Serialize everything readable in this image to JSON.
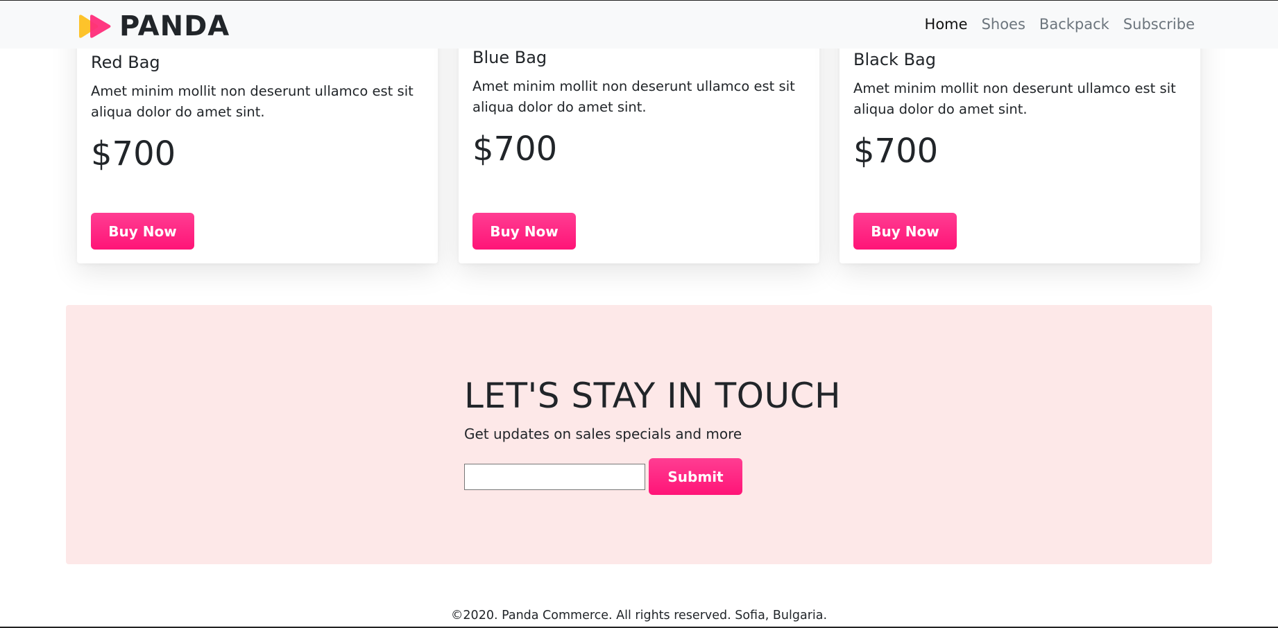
{
  "navbar": {
    "brand": "PANDA",
    "logo_icon": "panda-play-logo",
    "links": [
      "Home",
      "Shoes",
      "Backpack",
      "Subscribe"
    ],
    "active_link": "Home"
  },
  "products": [
    {
      "title": "Red Bag",
      "description": "Amet minim mollit non deserunt ullamco est sit aliqua dolor do amet sint.",
      "price": "$700",
      "button": "Buy Now"
    },
    {
      "title": "Blue Bag",
      "description": "Amet minim mollit non deserunt ullamco est sit aliqua dolor do amet sint.",
      "price": "$700",
      "button": "Buy Now"
    },
    {
      "title": "Black Bag",
      "description": "Amet minim mollit non deserunt ullamco est sit aliqua dolor do amet sint.",
      "price": "$700",
      "button": "Buy Now"
    }
  ],
  "subscribe": {
    "title": "LET'S STAY IN TOUCH",
    "subtitle": "Get updates on sales specials and more",
    "input_value": "",
    "submit_label": "Submit"
  },
  "footer": {
    "text": "©2020. Panda Commerce. All rights reserved. Sofia, Bulgaria."
  },
  "colors": {
    "accent": "#ff1f7f",
    "subscribe_bg": "#fde8e8",
    "navbar_bg": "#f8f9fa",
    "logo_yellow": "#fdc32b",
    "logo_pink": "#ff2d7a"
  }
}
